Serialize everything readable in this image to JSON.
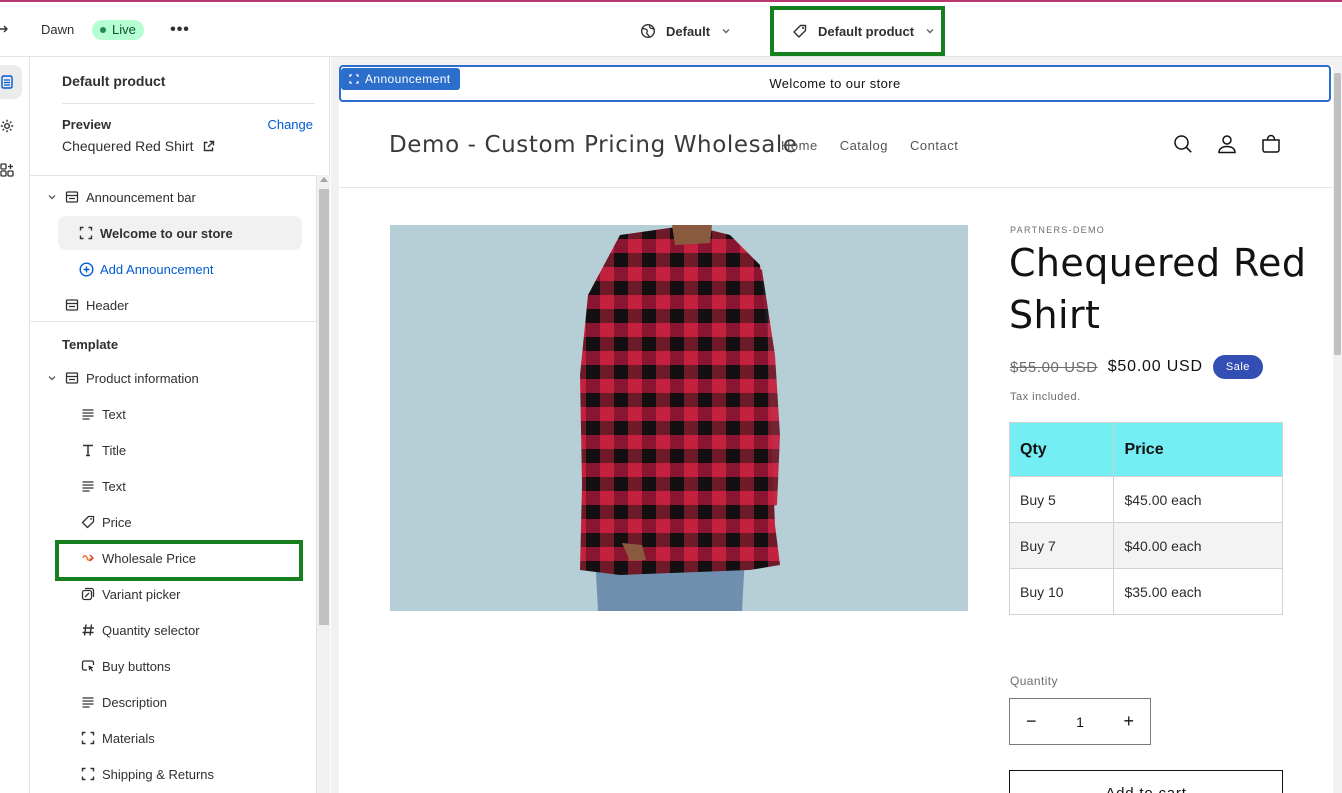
{
  "topbar": {
    "theme_name": "Dawn",
    "status_badge": "Live",
    "more_label": "•••",
    "language_select": "Default",
    "template_select": "Default product"
  },
  "sidebar": {
    "title": "Default product",
    "preview_label": "Preview",
    "change_link": "Change",
    "preview_product": "Chequered Red Shirt",
    "announcement_bar": "Announcement bar",
    "announcement_item": "Welcome to our store",
    "add_announcement": "Add Announcement",
    "header": "Header",
    "template_label": "Template",
    "product_information": "Product information",
    "blocks": [
      {
        "label": "Text",
        "icon": "text-lines-icon"
      },
      {
        "label": "Title",
        "icon": "title-t-icon"
      },
      {
        "label": "Text",
        "icon": "text-lines-icon"
      },
      {
        "label": "Price",
        "icon": "price-tag-icon"
      },
      {
        "label": "Wholesale Price",
        "icon": "app-block-icon"
      },
      {
        "label": "Variant picker",
        "icon": "variant-picker-icon"
      },
      {
        "label": "Quantity selector",
        "icon": "hash-icon"
      },
      {
        "label": "Buy buttons",
        "icon": "cursor-button-icon"
      },
      {
        "label": "Description",
        "icon": "text-lines-icon"
      },
      {
        "label": "Materials",
        "icon": "block-dashed-icon"
      },
      {
        "label": "Shipping & Returns",
        "icon": "block-dashed-icon"
      }
    ]
  },
  "preview": {
    "announcement_tag": "Announcement",
    "announcement_text": "Welcome to our store",
    "store_name": "Demo - Custom Pricing Wholesale",
    "nav": [
      "Home",
      "Catalog",
      "Contact"
    ],
    "vendor": "PARTNERS-DEMO",
    "product_title": "Chequered Red Shirt",
    "compare_price": "$55.00 USD",
    "price": "$50.00 USD",
    "sale_badge": "Sale",
    "tax_note": "Tax included.",
    "pricing_table": {
      "headers": [
        "Qty",
        "Price"
      ],
      "rows": [
        [
          "Buy 5",
          "$45.00 each"
        ],
        [
          "Buy 7",
          "$40.00 each"
        ],
        [
          "Buy 10",
          "$35.00 each"
        ]
      ]
    },
    "quantity_label": "Quantity",
    "quantity_minus": "−",
    "quantity_value": "1",
    "quantity_plus": "+",
    "add_to_cart": "Add to cart"
  },
  "colors": {
    "accent_blue": "#005bd3",
    "highlight_green": "#15801d",
    "table_header": "#74eef3",
    "sale_badge": "#334fb4",
    "live_badge": "#b4fed2"
  }
}
